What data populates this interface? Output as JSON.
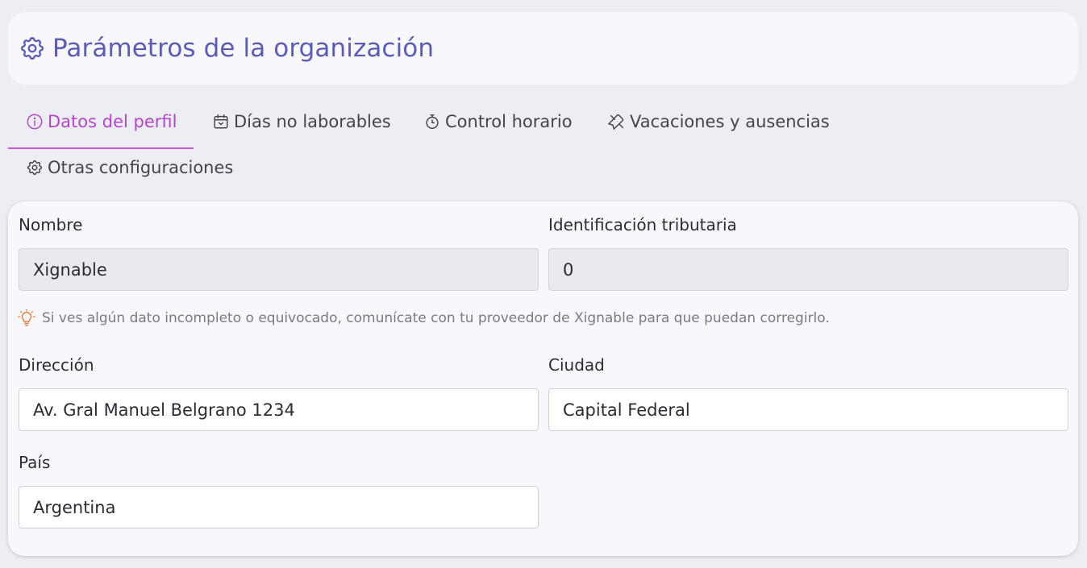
{
  "header": {
    "title": "Parámetros de la organización",
    "icon": "gear-icon"
  },
  "tabs": [
    {
      "label": "Datos del perfil",
      "icon": "info-icon",
      "active": true
    },
    {
      "label": "Días no laborables",
      "icon": "calendar-icon",
      "active": false
    },
    {
      "label": "Control horario",
      "icon": "stopwatch-icon",
      "active": false
    },
    {
      "label": "Vacaciones y ausencias",
      "icon": "plane-icon",
      "active": false
    },
    {
      "label": "Otras configuraciones",
      "icon": "gear-icon",
      "active": false
    }
  ],
  "form": {
    "nombre": {
      "label": "Nombre",
      "value": "Xignable"
    },
    "tax_id": {
      "label": "Identificación tributaria",
      "value": "0"
    },
    "hint": {
      "text": "Si ves algún dato incompleto o equivocado, comunícate con tu proveedor de Xignable para que puedan corregirlo.",
      "icon": "lightbulb-icon"
    },
    "direccion": {
      "label": "Dirección",
      "value": "Av. Gral Manuel Belgrano 1234"
    },
    "ciudad": {
      "label": "Ciudad",
      "value": "Capital Federal"
    },
    "pais": {
      "label": "País",
      "value": "Argentina"
    }
  },
  "colors": {
    "accent": "#5a5bb8",
    "active_tab": "#b445c8",
    "hint_icon": "#e07a3a",
    "background": "#eceef4"
  }
}
